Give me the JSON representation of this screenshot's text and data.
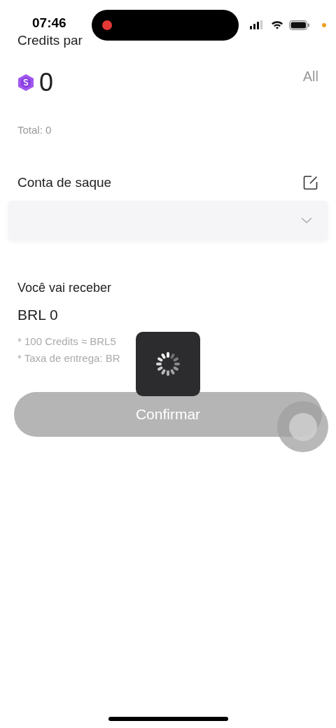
{
  "status_bar": {
    "time": "07:46",
    "recording": true
  },
  "header": {
    "title": "Credits par"
  },
  "balance": {
    "amount": "0",
    "all_link": "All",
    "total": "Total: 0"
  },
  "account": {
    "label": "Conta de saque"
  },
  "receive": {
    "label": "Você vai receber",
    "amount": "BRL 0",
    "notes": [
      "* 100 Credits ≈ BRL5",
      "* Taxa de entrega: BR"
    ]
  },
  "confirm_button": {
    "label": "Confirmar",
    "disabled": true
  },
  "loading": true
}
